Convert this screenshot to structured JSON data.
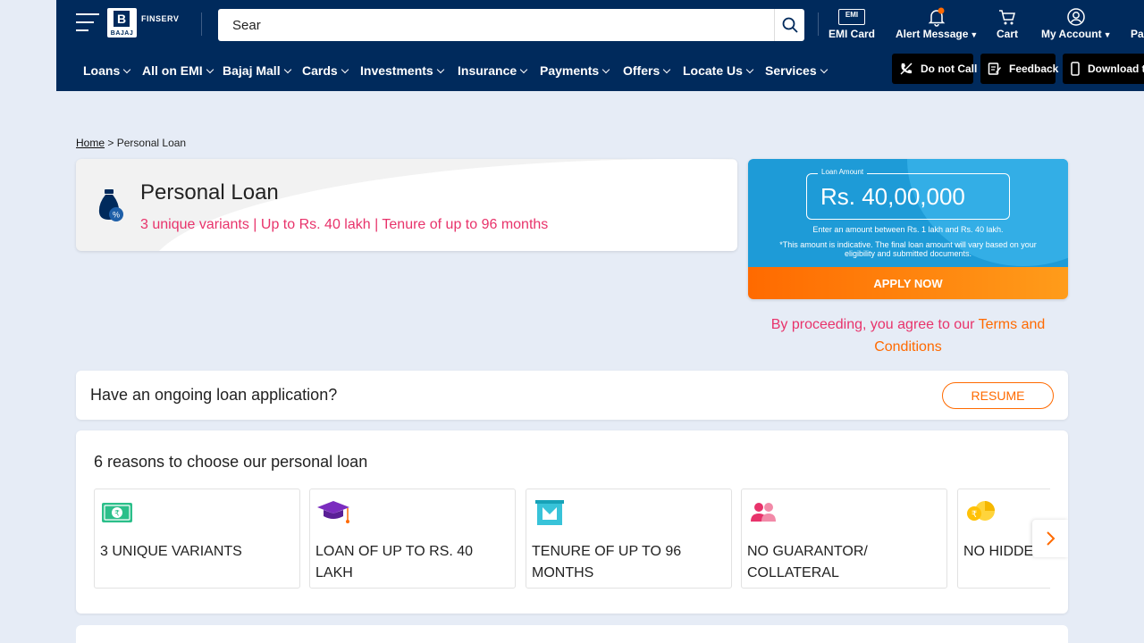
{
  "header": {
    "logo_text": "FINSERV",
    "logo_mark": "B",
    "logo_brand": "BAJAJ",
    "search": {
      "value": "Sear",
      "placeholder": "Search"
    },
    "tools": [
      {
        "label": "EMI Card",
        "icon": "emi-card-icon",
        "badge": "EMI"
      },
      {
        "label": "Alert Message",
        "icon": "bell-icon",
        "has_caret": true
      },
      {
        "label": "Cart",
        "icon": "cart-icon"
      },
      {
        "label": "My Account",
        "icon": "user-icon",
        "has_caret": true
      },
      {
        "label": "Pa",
        "icon": ""
      }
    ],
    "nav": [
      "Loans",
      "All on EMI",
      "Bajaj Mall",
      "Cards",
      "Investments",
      "Insurance",
      "Payments",
      "Offers",
      "Locate Us",
      "Services"
    ],
    "pills": [
      {
        "label": "Do not Call",
        "icon": "no-call-icon"
      },
      {
        "label": "Feedback",
        "icon": "feedback-icon"
      },
      {
        "label": "Download t",
        "icon": "phone-icon"
      }
    ],
    "colors": {
      "navy": "#002a5c",
      "notify_dot": "#ff6a00"
    }
  },
  "breadcrumb": {
    "home": "Home",
    "separator": ">",
    "current": "Personal Loan"
  },
  "loan": {
    "title": "Personal Loan",
    "subtitle": "3 unique variants | Up to Rs. 40 lakh | Tenure of up to 96 months",
    "icon": "money-bag-icon"
  },
  "apply": {
    "amount_label": "Loan Amount",
    "amount_value": "Rs. 40,00,000",
    "hint": "Enter an amount between Rs. 1 lakh and Rs. 40 lakh.",
    "note": "*This amount is indicative. The final loan amount will vary based on your eligibility and submitted documents.",
    "button": "APPLY NOW",
    "terms_prefix": "By proceeding, you agree to our ",
    "terms_link": "Terms and Conditions",
    "colors": {
      "blue": "#1e9bd7",
      "orange": "#ff6a00",
      "pink": "#e8336b"
    }
  },
  "ongoing": {
    "question": "Have an ongoing loan application?",
    "button": "RESUME"
  },
  "reasons": {
    "heading": "6 reasons to choose our personal loan",
    "items": [
      {
        "text": "3 UNIQUE VARIANTS",
        "icon": "rupee-note-icon"
      },
      {
        "text": "LOAN OF UP TO RS. 40 LAKH",
        "icon": "graduation-cap-icon"
      },
      {
        "text": "TENURE OF UP TO 96 MONTHS",
        "icon": "calendar-icon"
      },
      {
        "text": "NO GUARANTOR/ COLLATERAL",
        "icon": "people-icon"
      },
      {
        "text": "NO HIDDEN",
        "icon": "coins-icon"
      }
    ],
    "next_icon": "chevron-right-icon"
  }
}
